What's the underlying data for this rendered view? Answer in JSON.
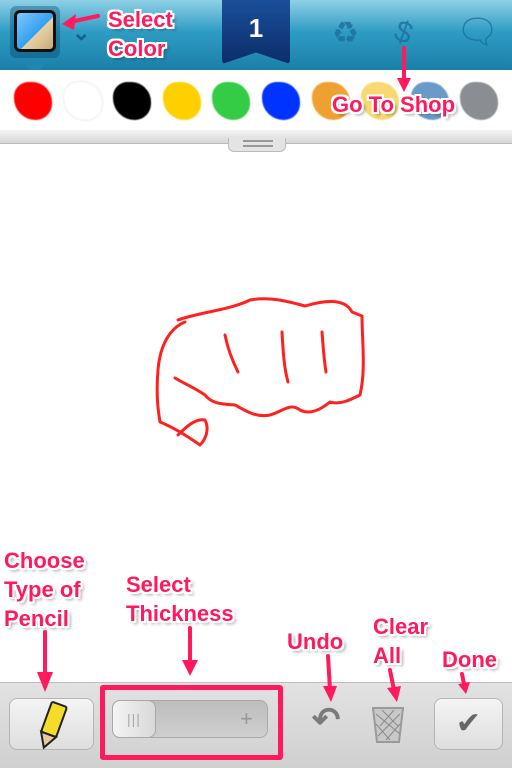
{
  "header": {
    "level_badge": "1",
    "icons": [
      "color-picker-icon",
      "chevron-down-icon",
      "recycle-icon",
      "price-tag-icon",
      "chat-bubble-icon"
    ]
  },
  "palette": {
    "colors": [
      "#ff0000",
      "#ffffff",
      "#000000",
      "#ffd000",
      "#33cc44",
      "#0033ff",
      "#f0a030",
      "#f8d870",
      "#6a9ac8",
      "#8a8d92"
    ]
  },
  "drawing": {
    "stroke_color": "#ff2020"
  },
  "toolbar": {
    "icons": [
      "pencil-icon",
      "undo-icon",
      "trash-icon",
      "checkmark-icon"
    ],
    "thickness_level": 0
  },
  "annotations": {
    "select_color": "Select\nColor",
    "go_to_shop": "Go To Shop",
    "choose_pencil": "Choose\nType of\nPencil",
    "select_thickness": "Select\nThickness",
    "undo": "Undo",
    "clear_all": "Clear\nAll",
    "done": "Done"
  },
  "accent": "#ff1a5e"
}
